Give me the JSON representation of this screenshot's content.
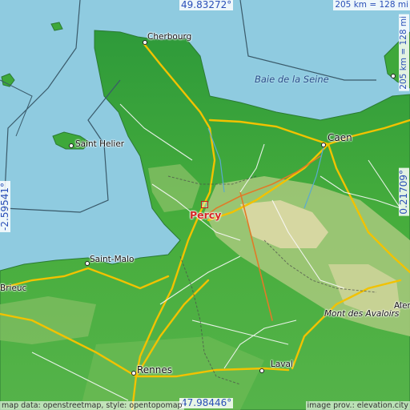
{
  "coords": {
    "north": "49.83272°",
    "south": "47.98446°",
    "west": "-2.59541°",
    "east": "0.21709°"
  },
  "scale": {
    "horizontal": "205 km = 128 mi",
    "vertical": "205 km = 128 mi"
  },
  "marker": {
    "label": "Percy"
  },
  "places": {
    "cherbourg": "Cherbourg",
    "caen": "Caen",
    "saint_helier": "Saint Helier",
    "saint_malo": "Saint-Malo",
    "brieuc": "Brieuc",
    "rennes": "Rennes",
    "laval": "Laval",
    "alencon": "Alen",
    "mont_des_avaloirs": "Mont des Avaloirs",
    "baie_de_la_seine": "Baie de la Seine"
  },
  "attribution": {
    "left": "map data: openstreetmap, style: opentopomap",
    "right": "image prov.: elevation.city"
  },
  "colors": {
    "sea": "#8fcbe0",
    "lowland": "#3ea83a",
    "upland": "#b9d08a",
    "highland": "#e2dcb0",
    "road_major": "#f2c200",
    "road_minor": "#ffffff"
  }
}
